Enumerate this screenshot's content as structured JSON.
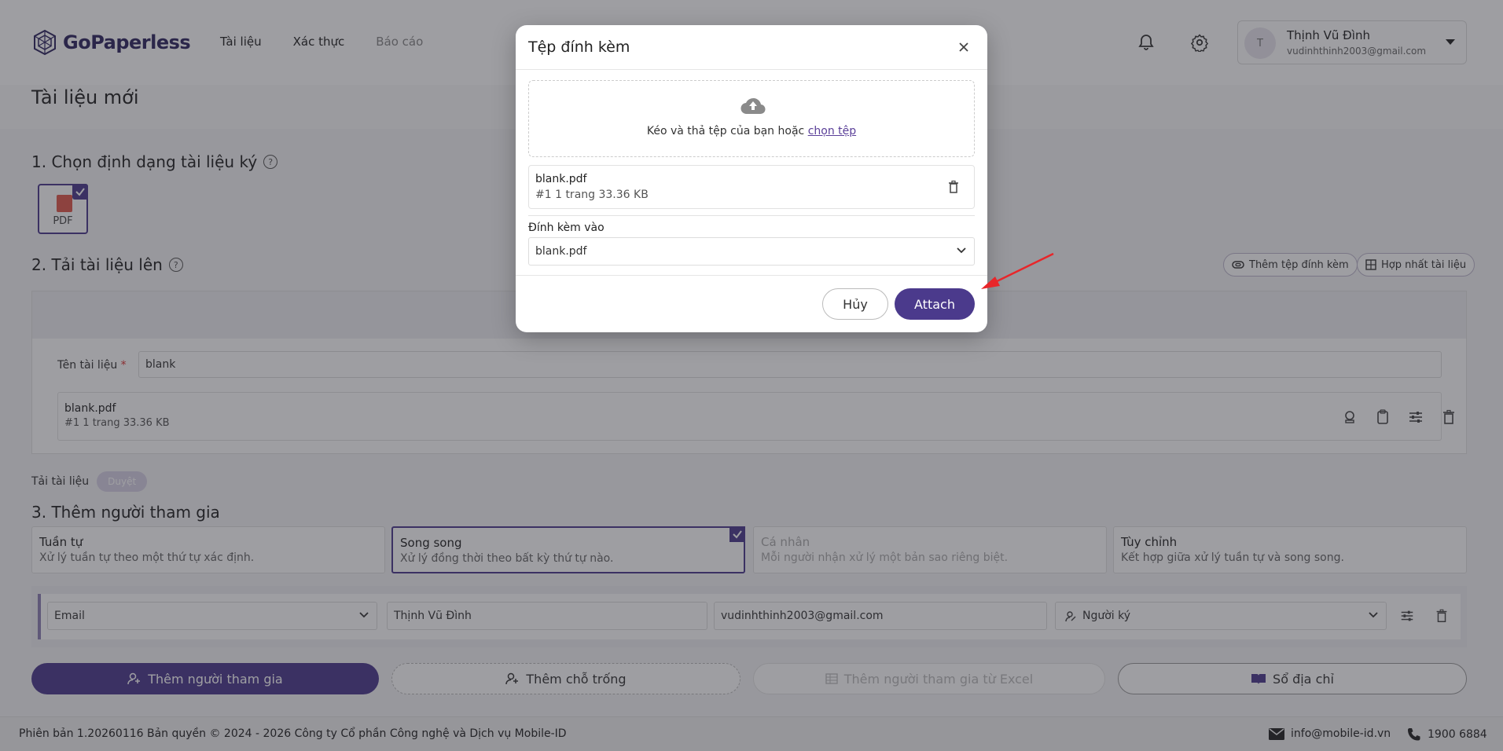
{
  "app": {
    "logo_text": "GoPaperless",
    "nav": [
      "Tài liệu",
      "Xác thực",
      "Báo cáo"
    ]
  },
  "user": {
    "initial": "T",
    "name": "Thịnh Vũ Đình",
    "email": "vudinhthinh2003@gmail.com"
  },
  "page": {
    "title": "Tài liệu mới",
    "section1": "1. Chọn định dạng tài liệu ký",
    "format_label": "PDF",
    "section2": "2. Tải tài liệu lên",
    "add_attachment_btn": "Thêm tệp đính kèm",
    "merge_btn": "Hợp nhất tài liệu",
    "doc_name_label": "Tên tài liệu",
    "doc_name_required": "*",
    "doc_name_value": "blank",
    "file": {
      "name": "blank.pdf",
      "meta": "#1  1 trang  33.36 KB"
    },
    "upload_label": "Tải tài liệu",
    "upload_status": "Duyệt",
    "section3": "3. Thêm người tham gia",
    "modes": [
      {
        "title": "Tuần tự",
        "desc": "Xử lý tuần tự theo một thứ tự xác định."
      },
      {
        "title": "Song song",
        "desc": "Xử lý đồng thời theo bất kỳ thứ tự nào."
      },
      {
        "title": "Cá nhân",
        "desc": "Mỗi người nhận xử lý một bản sao riêng biệt."
      },
      {
        "title": "Tùy chỉnh",
        "desc": "Kết hợp giữa xử lý tuần tự và song song."
      }
    ],
    "participant": {
      "type": "Email",
      "name": "Thịnh Vũ Đình",
      "email": "vudinhthinh2003@gmail.com",
      "role": "Người ký"
    },
    "buttons": {
      "add_participant": "Thêm người tham gia",
      "add_placeholder": "Thêm chỗ trống",
      "add_from_excel": "Thêm người tham gia từ Excel",
      "address_book": "Sổ địa chỉ"
    }
  },
  "footer": {
    "copyright": "Phiên bản 1.20260116 Bản quyền © 2024 - 2026 Công ty Cổ phần Công nghệ và Dịch vụ Mobile-ID",
    "email": "info@mobile-id.vn",
    "phone": "1900 6884"
  },
  "modal": {
    "title": "Tệp đính kèm",
    "dropzone_text": "Kéo và thả tệp của bạn hoặc",
    "dropzone_link": "chọn tệp",
    "file": {
      "name": "blank.pdf",
      "meta": "#1  1 trang  33.36 KB"
    },
    "attach_to_label": "Đính kèm vào",
    "attach_to_value": "blank.pdf",
    "cancel": "Hủy",
    "attach": "Attach"
  },
  "colors": {
    "brand": "#4b3a8c",
    "annotation_arrow": "#e8262a"
  }
}
